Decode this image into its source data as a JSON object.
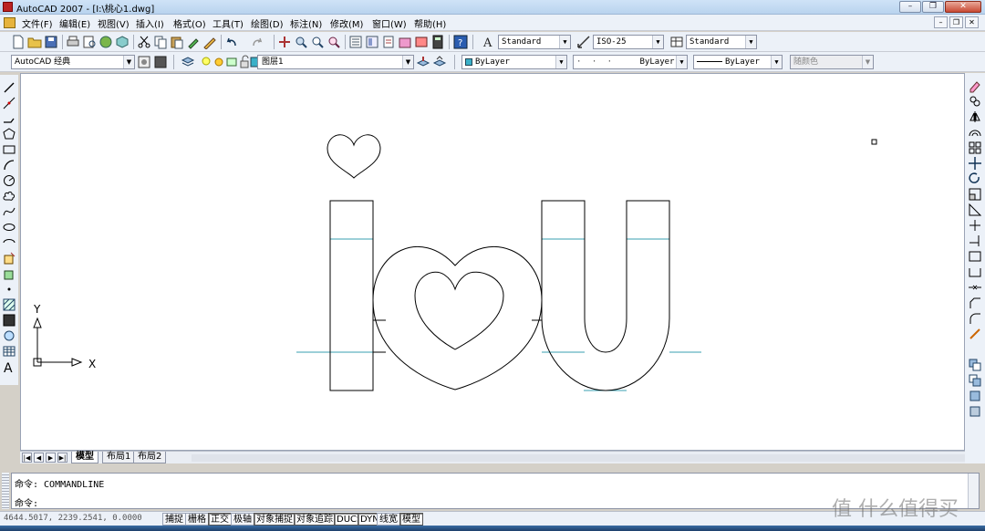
{
  "window": {
    "title": "AutoCAD 2007 - [I:\\桃心1.dwg]",
    "minimize_label": "–",
    "restore_label": "❐",
    "close_label": "✕"
  },
  "menu": {
    "items": [
      "文件(F)",
      "编辑(E)",
      "视图(V)",
      "插入(I)",
      "格式(O)",
      "工具(T)",
      "绘图(D)",
      "标注(N)",
      "修改(M)",
      "窗口(W)",
      "帮助(H)"
    ]
  },
  "toolbar1": {
    "text_style": "Standard",
    "dim_style": "ISO-25",
    "table_style": "Standard"
  },
  "toolbar2": {
    "workspace": "AutoCAD 经典",
    "layer": "图层1",
    "color": "ByLayer",
    "linetype": "ByLayer",
    "lineweight": "ByLayer",
    "plotstyle": "随颜色"
  },
  "ucs": {
    "y_label": "Y",
    "x_label": "X"
  },
  "tabs": [
    "模型",
    "布局1",
    "布局2"
  ],
  "command": {
    "history_line": "命令: COMMANDLINE",
    "prompt_line": "命令:"
  },
  "status": {
    "coordinates": "4644.5017, 2239.2541, 0.0000",
    "buttons": [
      {
        "label": "捕捉",
        "on": false
      },
      {
        "label": "栅格",
        "on": false
      },
      {
        "label": "正交",
        "on": true
      },
      {
        "label": "极轴",
        "on": false
      },
      {
        "label": "对象捕捉",
        "on": true
      },
      {
        "label": "对象追踪",
        "on": true
      },
      {
        "label": "DUCS",
        "on": true
      },
      {
        "label": "DYN",
        "on": true
      },
      {
        "label": "线宽",
        "on": false
      },
      {
        "label": "模型",
        "on": true
      }
    ]
  },
  "watermark": "值 什么值得买",
  "colors": {
    "construction_line": "#3a9fb0",
    "geometry": "#000000"
  }
}
